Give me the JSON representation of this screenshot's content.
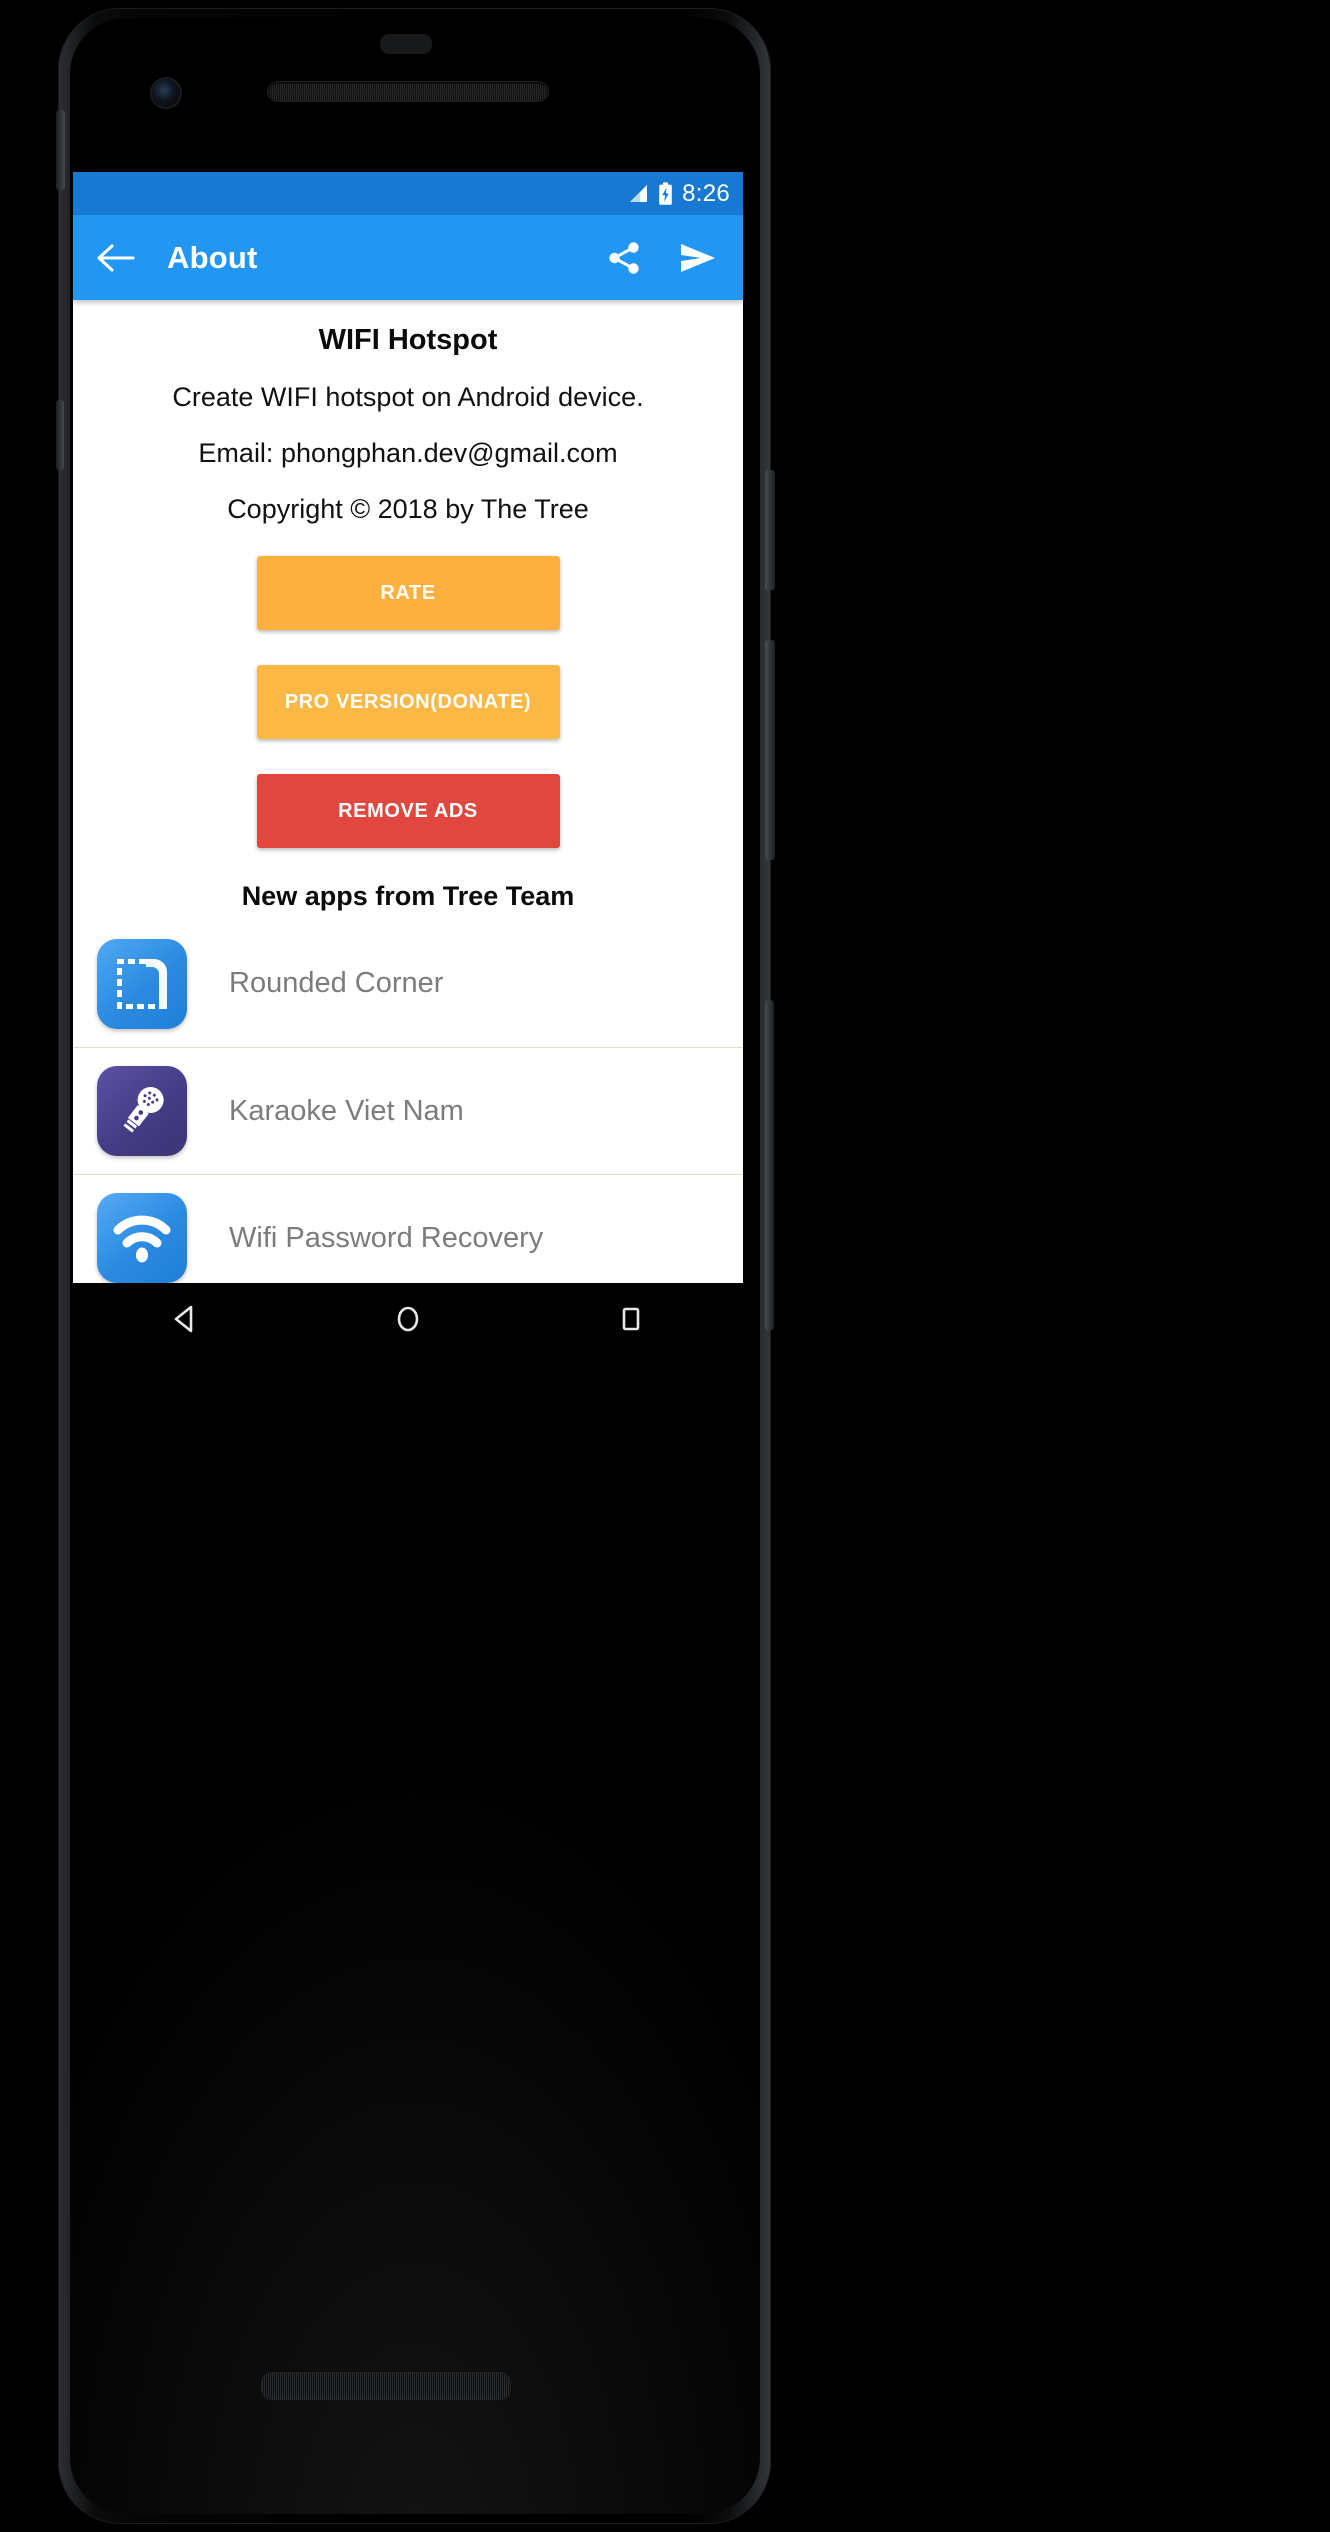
{
  "device": {
    "hardware": {
      "front_camera": "front-camera",
      "earpiece": "earpiece-speaker",
      "bottom_speaker": "bottom-speaker"
    }
  },
  "statusbar": {
    "signal_icon": "signal-bars-icon",
    "battery_icon": "battery-charging-icon",
    "time": "8:26",
    "background": "#1879d3"
  },
  "toolbar": {
    "back_icon": "back-arrow-icon",
    "title": "About",
    "share_icon": "share-icon",
    "send_icon": "send-icon",
    "background": "#2196f3"
  },
  "about": {
    "app_title": "WIFI Hotspot",
    "description": "Create WIFI hotspot on Android device.",
    "email": "Email: phongphan.dev@gmail.com",
    "copyright": "Copyright © 2018 by The Tree"
  },
  "buttons": {
    "rate": {
      "label": "RATE",
      "color": "#fbb03f"
    },
    "pro": {
      "label": "PRO VERSION(DONATE)",
      "color": "#fbb845"
    },
    "remove_ads": {
      "label": "REMOVE ADS",
      "color": "#e0483f"
    }
  },
  "apps_section": {
    "heading": "New apps from Tree Team",
    "items": [
      {
        "name": "Rounded Corner",
        "icon": "rounded-corner-app-icon",
        "color": "#2b8ae0"
      },
      {
        "name": "Karaoke Viet Nam",
        "icon": "microphone-app-icon",
        "color": "#453c86"
      },
      {
        "name": "Wifi Password Recovery",
        "icon": "wifi-app-icon",
        "color": "#2b8ae0"
      }
    ]
  },
  "navbar": {
    "back": "nav-back-triangle-icon",
    "home": "nav-home-circle-icon",
    "recents": "nav-recents-square-icon"
  }
}
